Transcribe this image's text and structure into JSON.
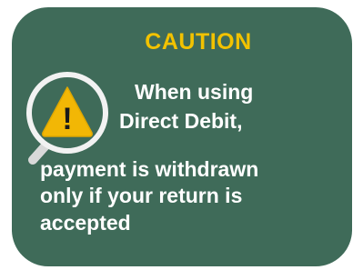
{
  "caution": {
    "title": "CAUTION",
    "lines": [
      "When using",
      "Direct Debit,",
      "payment is withdrawn",
      "only if your return is",
      "accepted"
    ]
  },
  "icon": {
    "name": "warning-magnifier-icon",
    "symbol": "!"
  },
  "colors": {
    "panel": "#3f6b59",
    "title": "#f2c200",
    "text": "#ffffff",
    "warning_triangle": "#f2b705"
  }
}
